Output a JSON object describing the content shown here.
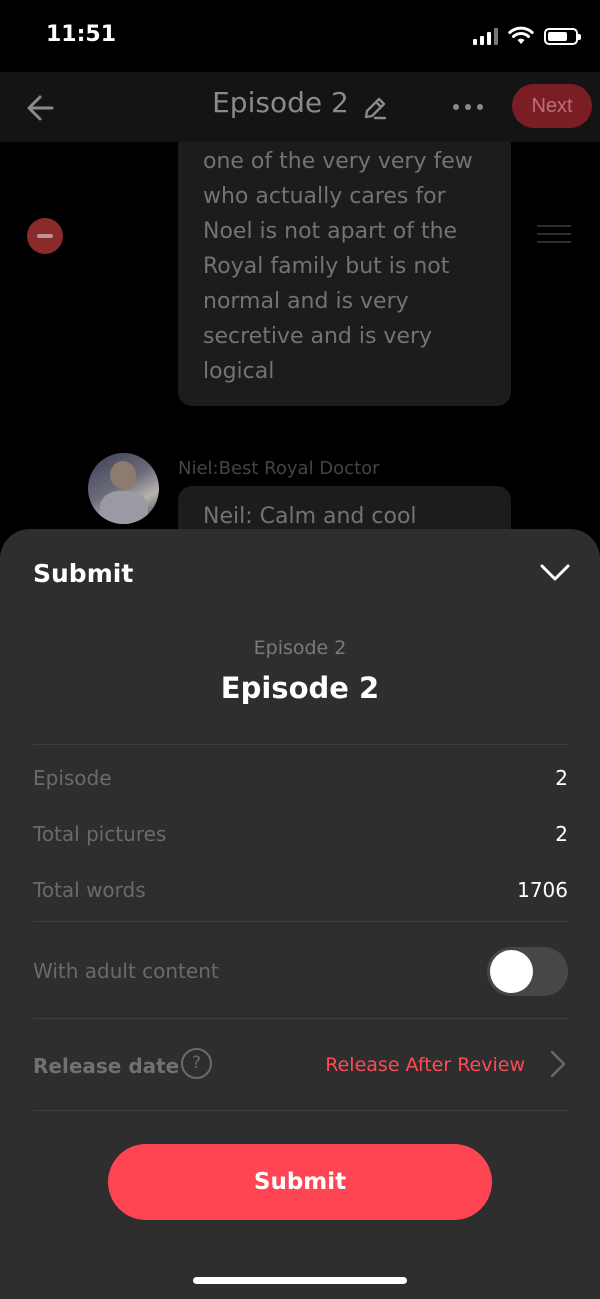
{
  "status_bar": {
    "time": "11:51"
  },
  "nav": {
    "title": "Episode 2",
    "next_label": "Next"
  },
  "chat": {
    "message_text": "one of the very very few\nwho actually cares for\nNoel is not apart of the\nRoyal family but is not\nnormal and is very\nsecretive and is very\nlogical",
    "speaker_name": "Niel:Best Royal Doctor",
    "next_message_text": "Neil: Calm and cool"
  },
  "sheet": {
    "title": "Submit",
    "episode_subtitle": "Episode 2",
    "episode_title": "Episode 2",
    "rows": [
      {
        "label": "Episode",
        "value": "2"
      },
      {
        "label": "Total pictures",
        "value": "2"
      },
      {
        "label": "Total words",
        "value": "1706"
      }
    ],
    "adult_content": {
      "label": "With adult content",
      "enabled": false
    },
    "release": {
      "label": "Release date",
      "help_glyph": "?",
      "value": "Release After Review"
    },
    "submit_label": "Submit"
  },
  "colors": {
    "accent": "#ff4553",
    "release_text": "#ff4a55",
    "sheet_bg": "#2e2e2e"
  }
}
